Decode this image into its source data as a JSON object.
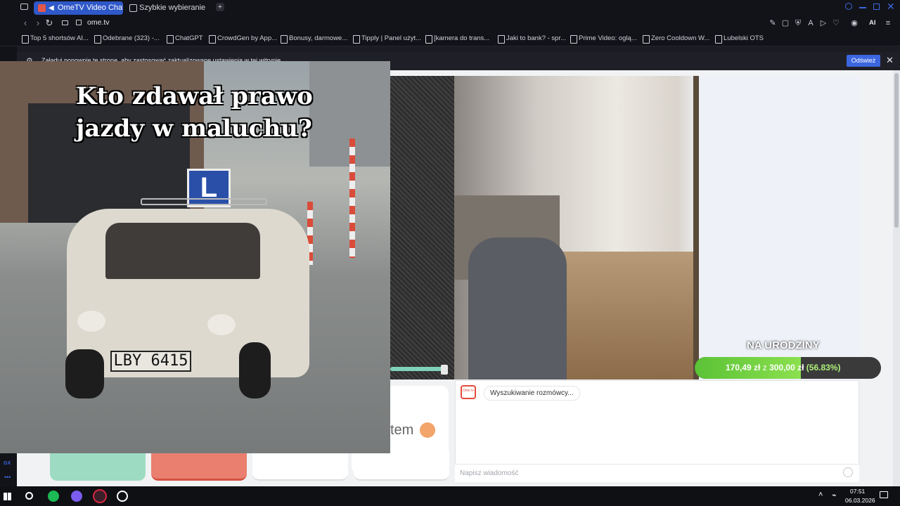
{
  "browser": {
    "tabs": [
      {
        "label": "OmeTV Video Chat —"
      },
      {
        "label": "Szybkie wybieranie"
      }
    ],
    "url": "ome.tv",
    "ai_label": "AI"
  },
  "bookmarks": [
    "Top 5 shortsów AI...",
    "Odebrane (323) -...",
    "ChatGPT",
    "CrowdGen by App...",
    "Bonusy, darmowe...",
    "Tipply | Panel użyt...",
    "[kamera do trans...",
    "Jaki to bank? - spr...",
    "Prime Video: oglą...",
    "Zero Cooldown W...",
    "Lubelski OTS"
  ],
  "infobar": {
    "message": "Załaduj ponownie tę stronę, aby zastosować zaktualizowane ustawienia w tej witrynie",
    "refresh": "Odśwież"
  },
  "overlay": {
    "title_line1": "Kto zdawał prawo",
    "title_line2": "jazdy w maluchu?",
    "plate": "LBY 6415",
    "sign": "L"
  },
  "donation": {
    "title": "NA URODZINY",
    "current": "170,49 zł",
    "sep": "z",
    "goal": "300,00 zł",
    "percent_text": "(56.83%)",
    "progress": 0.5683
  },
  "chat": {
    "status": "Wyszukiwanie rozmówcy...",
    "placeholder": "Napisz wiadomość",
    "logo_text": "Ome tv",
    "partial_text": "tem"
  },
  "taskbar": {
    "time": "07:51",
    "date": "06.03.2026"
  },
  "sidebar": {
    "label1": "GX"
  }
}
